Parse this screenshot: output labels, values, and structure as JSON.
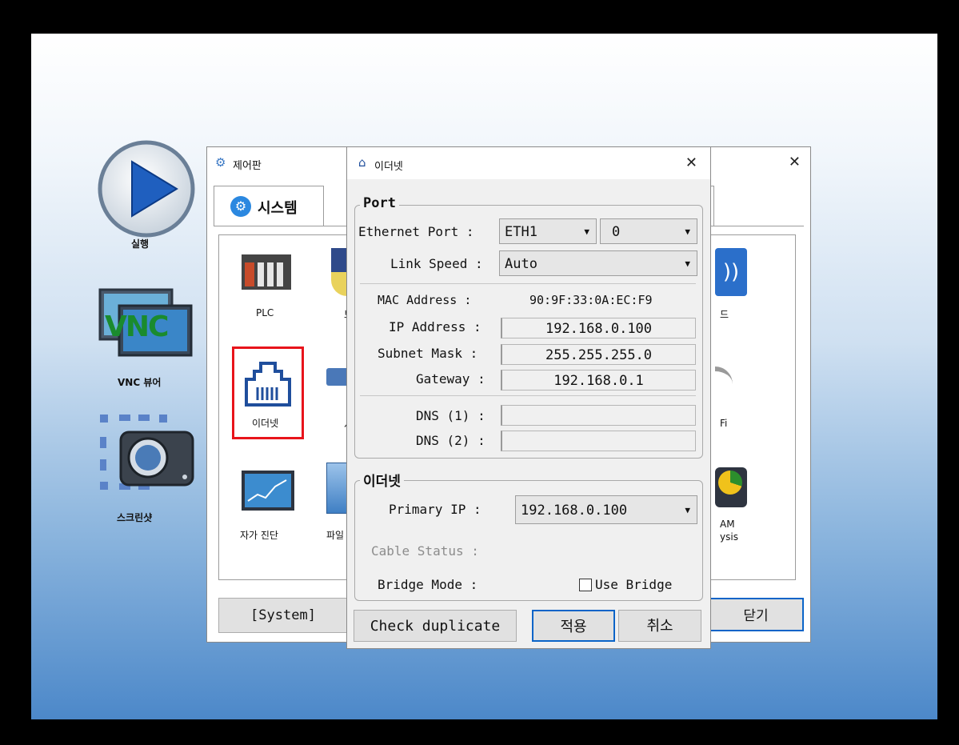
{
  "desktop": {
    "run_label": "실행",
    "vnc_label": "VNC 뷰어",
    "vnc_logo": "VNC",
    "screenshot_label": "스크린샷"
  },
  "control_panel": {
    "title": "제어판",
    "tab_system": "시스템",
    "items": {
      "plc": "PLC",
      "ethernet": "이더넷",
      "self_diag": "자가 진단",
      "file": "파일",
      "partial_bo": "보",
      "partial_si": "시",
      "partial_de": "드",
      "partial_fi": "Fi",
      "partial_am": "AM",
      "partial_ysis": "ysis"
    },
    "system_button": "[System]",
    "close_button": "닫기",
    "highlight_color": "#e8141b"
  },
  "ethernet_dialog": {
    "title": "이더넷",
    "port_group": "Port",
    "ethernet_port_label": "Ethernet Port :",
    "ethernet_port_value": "ETH1",
    "ethernet_port_index": "0",
    "link_speed_label": "Link Speed :",
    "link_speed_value": "Auto",
    "mac_label": "MAC Address :",
    "mac_value": "90:9F:33:0A:EC:F9",
    "ip_label": "IP Address :",
    "ip_value": "192.168.0.100",
    "subnet_label": "Subnet Mask :",
    "subnet_value": "255.255.255.0",
    "gateway_label": "Gateway :",
    "gateway_value": "192.168.0.1",
    "dns1_label": "DNS (1) :",
    "dns1_value": "",
    "dns2_label": "DNS (2) :",
    "dns2_value": "",
    "eth_group": "이더넷",
    "primary_ip_label": "Primary IP :",
    "primary_ip_value": "192.168.0.100",
    "cable_status_label": "Cable Status :",
    "bridge_mode_label": "Bridge Mode :",
    "use_bridge_label": "Use Bridge",
    "check_duplicate": "Check duplicate",
    "apply": "적용",
    "cancel": "취소"
  }
}
